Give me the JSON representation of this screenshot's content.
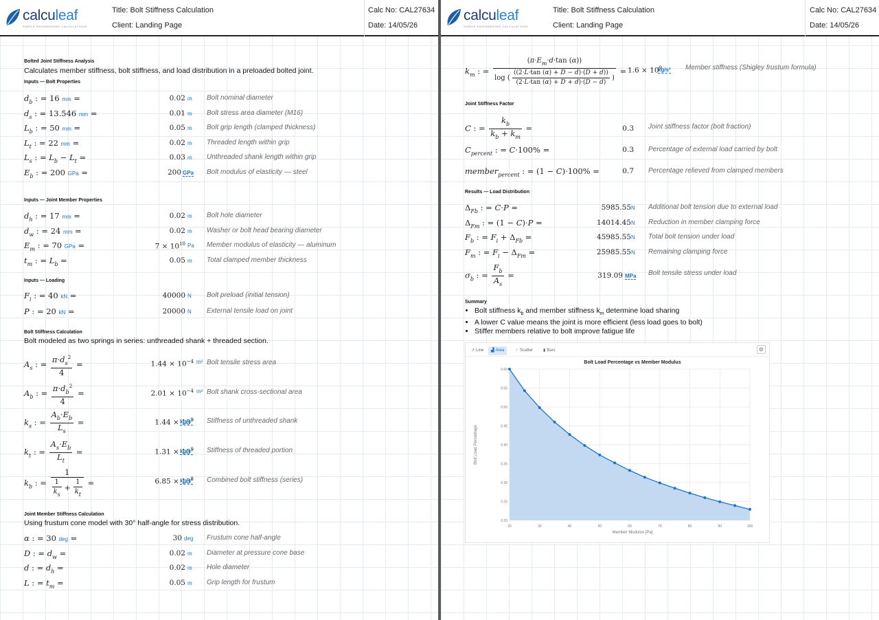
{
  "header": {
    "logo_text_a": "calcu",
    "logo_text_b": "leaf",
    "logo_tagline": "SIMPLE ENGINEERING CALCULATIONS",
    "title": "Title: Bolt Stiffness Calculation",
    "client": "Client: Landing Page",
    "calc_no": "Calc No: CAL27634",
    "date": "Date: 14/05/26"
  },
  "left": {
    "analysis_title": "Bolted Joint Stiffness Analysis",
    "analysis_desc": "Calculates member stiffness, bolt stiffness, and load distribution in a preloaded bolted joint.",
    "bolt_props_title": "Inputs — Bolt Properties",
    "bolt_props": [
      {
        "sym": "d",
        "sub": "b",
        "rhs": "= 16",
        "u": "mm",
        "val": "0.02",
        "unit": "m",
        "note": "Bolt nominal diameter"
      },
      {
        "sym": "d",
        "sub": "s",
        "rhs": "= 13.546",
        "u": "mm",
        "val": "0.01",
        "unit": "m",
        "note": "Bolt stress area diameter (M16)"
      },
      {
        "sym": "L",
        "sub": "b",
        "rhs": "= 50",
        "u": "mm",
        "val": "0.05",
        "unit": "m",
        "note": "Bolt grip length (clamped thickness)"
      },
      {
        "sym": "L",
        "sub": "t",
        "rhs": "= 22",
        "u": "mm",
        "val": "0.02",
        "unit": "m",
        "note": "Threaded length within grip"
      },
      {
        "sym": "L",
        "sub": "s",
        "rhs": "= L_b − L_t",
        "u": "",
        "val": "0.03",
        "unit": "m",
        "note": "Unthreaded shank length within grip"
      },
      {
        "sym": "E",
        "sub": "b",
        "rhs": "= 200",
        "u": "GPa",
        "val": "200",
        "unit": "GPa",
        "note": "Bolt modulus of elasticity — steel"
      }
    ],
    "joint_props_title": "Inputs — Joint Member Properties",
    "joint_props": [
      {
        "sym": "d",
        "sub": "h",
        "rhs": "= 17",
        "u": "mm",
        "val": "0.02",
        "unit": "m",
        "note": "Bolt hole diameter"
      },
      {
        "sym": "d",
        "sub": "w",
        "rhs": "= 24",
        "u": "mm",
        "val": "0.02",
        "unit": "m",
        "note": "Washer or bolt head bearing diameter"
      },
      {
        "sym": "E",
        "sub": "m",
        "rhs": "= 70",
        "u": "GPa",
        "val": "7 × 10",
        "sup": "10",
        "unit": "Pa",
        "note": "Member modulus of elasticity — aluminum"
      },
      {
        "sym": "t",
        "sub": "m",
        "rhs": "= L_b",
        "u": "",
        "val": "0.05",
        "unit": "m",
        "note": "Total clamped member thickness"
      }
    ],
    "loading_title": "Inputs — Loading",
    "loading": [
      {
        "sym": "F",
        "sub": "i",
        "rhs": "= 40",
        "u": "kN",
        "val": "40000",
        "unit": "N",
        "note": "Bolt preload (initial tension)"
      },
      {
        "sym": "P",
        "sub": "",
        "rhs": "= 20",
        "u": "kN",
        "val": "20000",
        "unit": "N",
        "note": "External tensile load on joint"
      }
    ],
    "bolt_stiff_title": "Bolt Stiffness Calculation",
    "bolt_stiff_desc": "Bolt modeled as two springs in series: unthreaded shank + threaded section.",
    "bolt_stiff": [
      {
        "val": "1.44 × 10",
        "sup": "−4",
        "unit": "m²",
        "note": "Bolt tensile stress area"
      },
      {
        "val": "2.01 × 10",
        "sup": "−4",
        "unit": "m²",
        "note": "Bolt shank cross-sectional area"
      },
      {
        "val": "1.44 × 10",
        "sup": "9",
        "unit": "kg/s²",
        "note": "Stiffness of unthreaded shank"
      },
      {
        "val": "1.31 × 10",
        "sup": "9",
        "unit": "kg/s²",
        "note": "Stiffness of threaded portion"
      },
      {
        "val": "6.85 × 10",
        "sup": "8",
        "unit": "kg/s²",
        "note": "Combined bolt stiffness (series)"
      }
    ],
    "member_title": "Joint Member Stiffness Calculation",
    "member_desc": "Using frustum cone model with 30° half-angle for stress distribution.",
    "member": [
      {
        "sym": "α",
        "sub": "",
        "rhs": "= 30",
        "u": "deg",
        "val": "30",
        "unit": "deg",
        "note": "Frustum cone half-angle"
      },
      {
        "sym": "D",
        "sub": "",
        "rhs": "= d_w",
        "u": "",
        "val": "0.02",
        "unit": "m",
        "note": "Diameter at pressure cone base"
      },
      {
        "sym": "d",
        "sub": "",
        "rhs": "= d_h",
        "u": "",
        "val": "0.02",
        "unit": "m",
        "note": "Hole diameter"
      },
      {
        "sym": "L",
        "sub": "",
        "rhs": "= t_m",
        "u": "",
        "val": "0.05",
        "unit": "m",
        "note": "Grip length for frustum"
      }
    ]
  },
  "right": {
    "km": {
      "val": "1.6 × 10",
      "sup": "9",
      "unit": "kg/s²",
      "note": "Member stiffness (Shigley frustum formula)"
    },
    "factor_title": "Joint Stiffness Factor",
    "factor": [
      {
        "val": "0.3",
        "note": "Joint stiffness factor (bolt fraction)"
      },
      {
        "val": "0.3",
        "note": "Percentage of external load carried by bolt"
      },
      {
        "val": "0.7",
        "note": "Percentage relieved from clamped members"
      }
    ],
    "results_title": "Results — Load Distribution",
    "results": [
      {
        "val": "5985.55",
        "unit": "N",
        "note": "Additional bolt tension due to external load"
      },
      {
        "val": "14014.45",
        "unit": "N",
        "note": "Reduction in member clamping force"
      },
      {
        "val": "45985.55",
        "unit": "N",
        "note": "Total bolt tension under load"
      },
      {
        "val": "25985.55",
        "unit": "N",
        "note": "Remaining clamping force"
      },
      {
        "val": "319.09",
        "unit": "MPa",
        "note": "Bolt tensile stress under load"
      }
    ],
    "summary_title": "Summary",
    "summary": [
      {
        "a": "Bolt stiffness k",
        "s1": "b",
        "b": " and member stiffness k",
        "s2": "m",
        "c": " determine load sharing"
      },
      {
        "a": "A lower C value means the joint is more efficient (less load goes to bolt)"
      },
      {
        "a": "Stiffer members relative to bolt improve fatigue life"
      }
    ]
  },
  "chart_tabs": [
    {
      "label": "Line",
      "icon": "line-chart-icon"
    },
    {
      "label": "Area",
      "icon": "area-chart-icon"
    },
    {
      "label": "Scatter",
      "icon": "scatter-chart-icon"
    },
    {
      "label": "Bars",
      "icon": "bar-chart-icon"
    }
  ],
  "chart_data": {
    "type": "area",
    "title": "Bolt Load Percentage vs Member Modulus",
    "xlabel": "Member Modulus [Pa]",
    "ylabel": "Bolt Load Percentage",
    "x": [
      20,
      25,
      30,
      35,
      40,
      45,
      50,
      55,
      60,
      65,
      70,
      75,
      80,
      85,
      90,
      95,
      100
    ],
    "y": [
      0.6,
      0.543,
      0.498,
      0.46,
      0.427,
      0.398,
      0.373,
      0.352,
      0.332,
      0.314,
      0.299,
      0.285,
      0.272,
      0.26,
      0.249,
      0.239,
      0.229
    ],
    "xticks": [
      "20",
      "30",
      "40",
      "50",
      "60",
      "70",
      "80",
      "90",
      "100"
    ],
    "yticks": [
      "0.20",
      "0.25",
      "0.30",
      "0.35",
      "0.40",
      "0.45",
      "0.50",
      "0.55",
      "0.60"
    ],
    "xlim": [
      20,
      100
    ],
    "ylim": [
      0.2,
      0.6
    ],
    "grid": true,
    "active_tab": "Area",
    "color": "#1b73c8"
  }
}
